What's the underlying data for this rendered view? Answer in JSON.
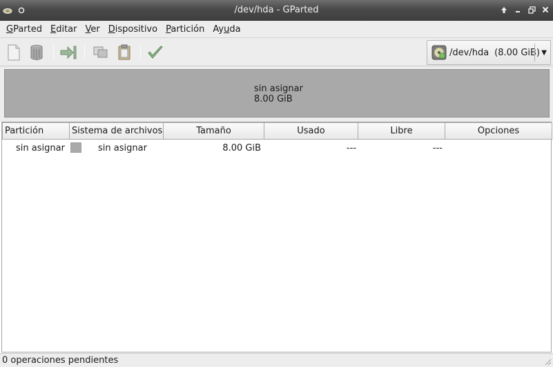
{
  "window": {
    "title": "/dev/hda - GParted"
  },
  "menubar": {
    "items": [
      {
        "mnemonic": "G",
        "rest": "Parted"
      },
      {
        "mnemonic": "E",
        "rest": "ditar"
      },
      {
        "mnemonic": "V",
        "rest": "er"
      },
      {
        "mnemonic": "D",
        "rest": "ispositivo"
      },
      {
        "mnemonic": "P",
        "rest": "artición"
      },
      {
        "pre": "Ay",
        "mnemonic": "u",
        "rest": "da"
      }
    ]
  },
  "toolbar": {
    "buttons": [
      "new-icon",
      "delete-icon",
      "resize-move-icon",
      "copy-icon",
      "paste-icon",
      "apply-icon"
    ],
    "device": {
      "name": "/dev/hda",
      "size": "(8.00 GiB)"
    }
  },
  "diskmap": {
    "label_line1": "sin asignar",
    "label_line2": "8.00 GiB",
    "color": "#a9a9a9"
  },
  "table": {
    "headers": [
      "Partición",
      "Sistema de archivos",
      "Tamaño",
      "Usado",
      "Libre",
      "Opciones"
    ],
    "rows": [
      {
        "partition": "sin asignar",
        "filesystem": "sin asignar",
        "size": "8.00 GiB",
        "used": "---",
        "free": "---",
        "flags": "",
        "color": "#a9a9a9"
      }
    ]
  },
  "status": {
    "text": "0 operaciones pendientes"
  }
}
